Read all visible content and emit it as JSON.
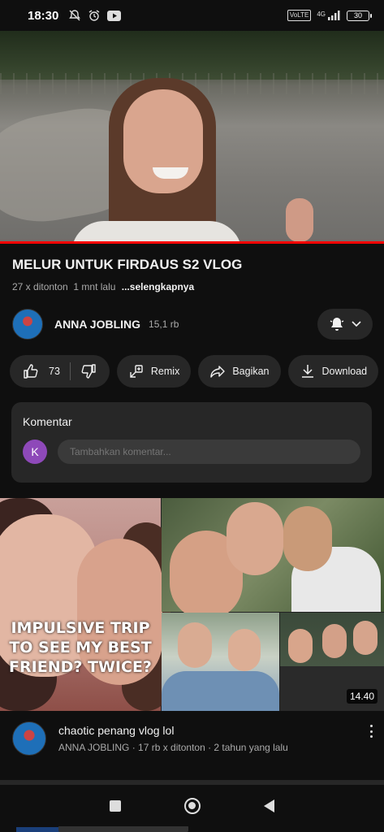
{
  "status_bar": {
    "time": "18:30",
    "badge_volte": "VoLTE",
    "network": "4G",
    "battery": "30"
  },
  "player": {
    "progress_fraction": 1.0
  },
  "video": {
    "title": "MELUR UNTUK FIRDAUS S2 VLOG",
    "views": "27 x ditonton",
    "age": "1 mnt lalu",
    "more": "...selengkapnya"
  },
  "channel": {
    "name": "ANNA JOBLING",
    "subscribers": "15,1 rb"
  },
  "actions": {
    "like_count": "73",
    "remix": "Remix",
    "share": "Bagikan",
    "download": "Download"
  },
  "comments": {
    "label": "Komentar",
    "avatar_letter": "K",
    "placeholder": "Tambahkan komentar..."
  },
  "next_video": {
    "thumb_text_line1": "IMPULSIVE TRIP",
    "thumb_text_line2": "TO SEE MY BEST",
    "thumb_text_line3": "FRIEND? TWICE?",
    "duration": "14.40",
    "title": "chaotic penang vlog lol",
    "meta": "ANNA JOBLING · 17 rb x ditonton · 2 tahun yang lalu"
  },
  "colors": {
    "background": "#0f0f0f",
    "surface": "#272727",
    "progress": "#ff0000",
    "comment_avatar": "#8e49b9"
  },
  "icons": [
    "mute-icon",
    "alarm-icon",
    "youtube-icon",
    "signal-icon",
    "battery-icon",
    "bell-icon",
    "chevron-down-icon",
    "thumbs-up-icon",
    "thumbs-down-icon",
    "remix-icon",
    "share-icon",
    "download-icon",
    "more-vert-icon",
    "nav-recents-icon",
    "nav-home-icon",
    "nav-back-icon"
  ]
}
